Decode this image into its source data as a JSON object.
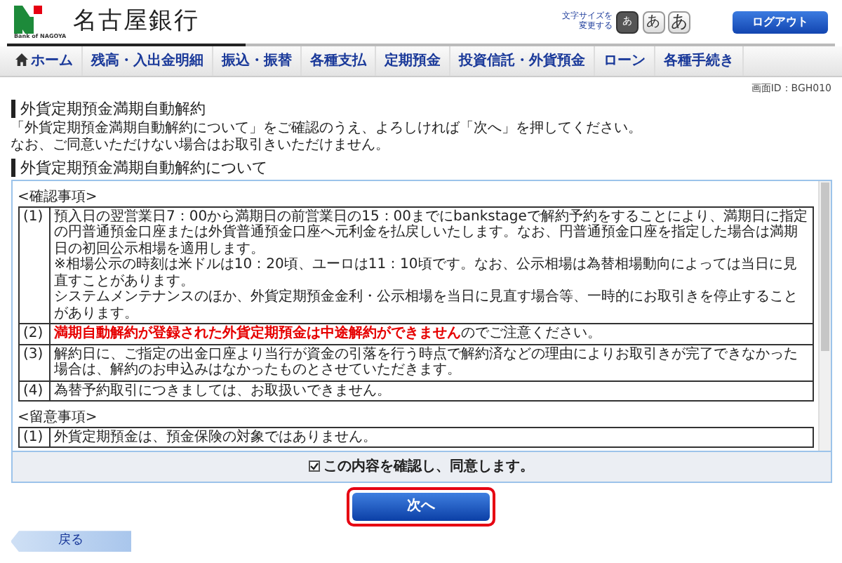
{
  "header": {
    "bank_name": "名古屋銀行",
    "logo_caption": "Bank of NAGOYA",
    "font_size_label": [
      "文字サイズを",
      "変更する"
    ],
    "font_size_options": [
      {
        "label": "あ",
        "kind": "small",
        "selected": true
      },
      {
        "label": "あ",
        "kind": "medium",
        "selected": false
      },
      {
        "label": "あ",
        "kind": "large",
        "selected": false
      }
    ],
    "logout": "ログアウト"
  },
  "nav": [
    {
      "label": "ホーム",
      "kind": "home"
    },
    {
      "label": "残高・入出金明細",
      "kind": "plain"
    },
    {
      "label": "振込・振替",
      "kind": "plain"
    },
    {
      "label": "各種支払",
      "kind": "plain"
    },
    {
      "label": "定期預金",
      "kind": "plain"
    },
    {
      "label": "投資信託・外貨預金",
      "kind": "plain"
    },
    {
      "label": "ローン",
      "kind": "plain"
    },
    {
      "label": "各種手続き",
      "kind": "plain"
    }
  ],
  "screen_id": "画面ID：BGH010",
  "title": "外貨定期預金満期自動解約",
  "description": [
    "「外貨定期預金満期自動解約について」をご確認のうえ、よろしければ「次へ」を押してください。",
    "なお、ご同意いただけない場合はお取引きいただけません。"
  ],
  "section_title": "外貨定期預金満期自動解約について",
  "terms": [
    {
      "heading": "<確認事項>",
      "items": [
        {
          "number": "(1)",
          "paragraphs": [
            [
              {
                "text": "預入日の翌営業日7：00から満期日の前営業日の15：00までにbankstageで解約予約をすることにより、満期日に指定の円普通預金口座または外貨普通預金口座へ元利金を払戻しいたします。なお、円普通預金口座を指定した場合は満期日の初回公示相場を適用します。",
                "kind": "normal"
              }
            ],
            [
              {
                "text": "※相場公示の時刻は米ドルは10：20頃、ユーロは11：10頃です。なお、公示相場は為替相場動向によっては当日に見直すことがあります。",
                "kind": "normal"
              }
            ],
            [
              {
                "text": "システムメンテナンスのほか、外貨定期預金金利・公示相場を当日に見直す場合等、一時的にお取引きを停止することがあります。",
                "kind": "normal"
              }
            ]
          ]
        },
        {
          "number": "(2)",
          "paragraphs": [
            [
              {
                "text": "満期自動解約が登録された外貨定期預金は中途解約ができません",
                "kind": "warning"
              },
              {
                "text": "のでご注意ください。",
                "kind": "normal"
              }
            ]
          ]
        },
        {
          "number": "(3)",
          "paragraphs": [
            [
              {
                "text": "解約日に、ご指定の出金口座より当行が資金の引落を行う時点で解約済などの理由によりお取引きが完了できなかった場合は、解約のお申込みはなかったものとさせていただきます。",
                "kind": "normal"
              }
            ]
          ]
        },
        {
          "number": "(4)",
          "paragraphs": [
            [
              {
                "text": "為替予約取引につきましては、お取扱いできません。",
                "kind": "normal"
              }
            ]
          ]
        }
      ]
    },
    {
      "heading": "<留意事項>",
      "items": [
        {
          "number": "(1)",
          "paragraphs": [
            [
              {
                "text": "外貨定期預金は、預金保険の対象ではありません。",
                "kind": "normal"
              }
            ]
          ]
        }
      ]
    }
  ],
  "agree": {
    "label": "この内容を確認し、同意します。",
    "checked": true
  },
  "next_button": "次へ",
  "back_button": "戻る"
}
